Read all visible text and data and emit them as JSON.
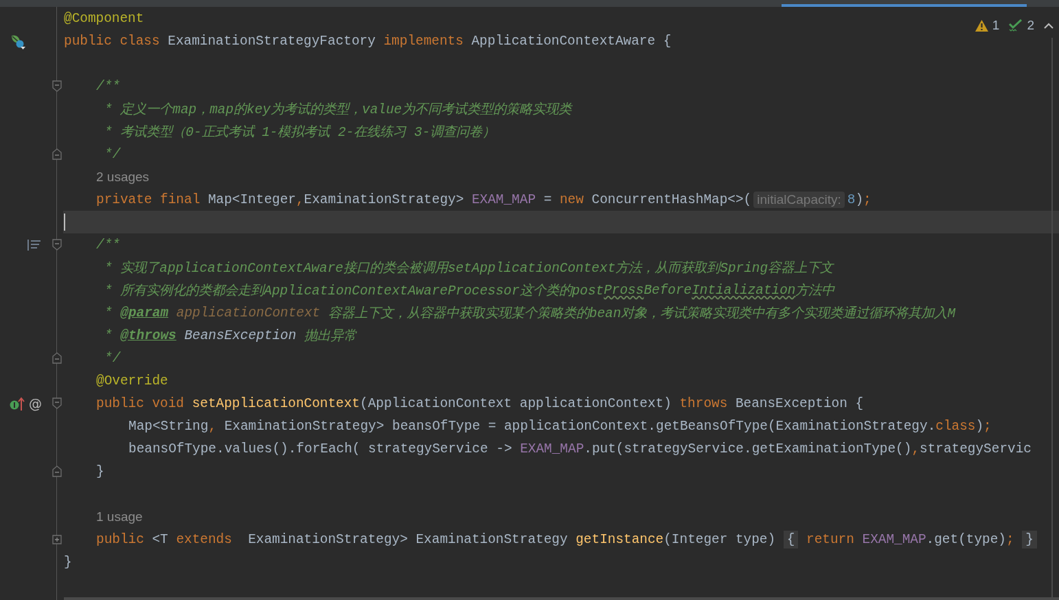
{
  "inspections": [
    {
      "kind": "warning",
      "count": "1"
    },
    {
      "kind": "typo",
      "count": "2"
    }
  ],
  "lines": [
    {
      "kind": "code",
      "block": {
        "kind": "top"
      },
      "tokens": [
        {
          "kind": "annot",
          "text": "@Component"
        }
      ]
    },
    {
      "kind": "code",
      "block": {
        "kind": "top"
      },
      "gutter": [
        {
          "kind": "bean"
        }
      ],
      "tokens": [
        {
          "kind": "kw",
          "text": "public class "
        },
        {
          "kind": "plain",
          "text": "ExaminationStrategyFactory "
        },
        {
          "kind": "kw",
          "text": "implements "
        },
        {
          "kind": "plain",
          "text": "ApplicationContextAware {"
        }
      ]
    },
    {
      "kind": "code",
      "block": {
        "kind": "top"
      }
    },
    {
      "kind": "code",
      "block": {
        "kind": "member"
      },
      "fold": {
        "kind": "start"
      },
      "tokens": [
        {
          "kind": "doc",
          "text": "/**"
        }
      ]
    },
    {
      "kind": "code",
      "block": {
        "kind": "doc"
      },
      "tokens": [
        {
          "kind": "doc",
          "text": "* 定义一个map，map的key为考试的类型，value为不同考试类型的策略实现类"
        }
      ]
    },
    {
      "kind": "code",
      "block": {
        "kind": "doc"
      },
      "tokens": [
        {
          "kind": "doc",
          "text": "* 考试类型（0-正式考试 1-模拟考试 2-在线练习 3-调查问卷）"
        }
      ]
    },
    {
      "kind": "code",
      "block": {
        "kind": "doc"
      },
      "fold": {
        "kind": "end"
      },
      "tokens": [
        {
          "kind": "doc",
          "text": "*/"
        }
      ]
    },
    {
      "kind": "code",
      "block": {
        "kind": "member"
      },
      "tokens": [
        {
          "kind": "usage",
          "text": "2 usages"
        }
      ]
    },
    {
      "kind": "code",
      "block": {
        "kind": "member"
      },
      "tokens": [
        {
          "kind": "kw",
          "text": "private final "
        },
        {
          "kind": "plain",
          "text": "Map<Integer"
        },
        {
          "kind": "kw",
          "text": ","
        },
        {
          "kind": "plain",
          "text": "ExaminationStrategy> "
        },
        {
          "kind": "field",
          "text": "EXAM_MAP"
        },
        {
          "kind": "plain",
          "text": " = "
        },
        {
          "kind": "kw",
          "text": "new "
        },
        {
          "kind": "plain",
          "text": "ConcurrentHashMap<>("
        },
        {
          "kind": "hint",
          "text": "initialCapacity:"
        },
        {
          "kind": "num",
          "text": "8"
        },
        {
          "kind": "plain",
          "text": ")"
        },
        {
          "kind": "kw",
          "text": ";"
        }
      ]
    },
    {
      "kind": "caret",
      "block": {
        "kind": "top"
      }
    },
    {
      "kind": "code",
      "block": {
        "kind": "member"
      },
      "fold": {
        "kind": "start"
      },
      "gutter": [
        {
          "kind": "doc-render"
        }
      ],
      "tokens": [
        {
          "kind": "doc",
          "text": "/**"
        }
      ]
    },
    {
      "kind": "code",
      "block": {
        "kind": "doc"
      },
      "tokens": [
        {
          "kind": "doc",
          "text": "* 实现了applicationContextAware接口的类会被调用setApplicationContext方法，从而获取到Spring容器上下文"
        }
      ]
    },
    {
      "kind": "code",
      "block": {
        "kind": "doc"
      },
      "tokens": [
        {
          "kind": "doc",
          "text": "* 所有实例化的类都会走到ApplicationContextAwareProcessor这个类的post"
        },
        {
          "kind": "typo",
          "text": "Pross"
        },
        {
          "kind": "doc",
          "text": "Before"
        },
        {
          "kind": "typo",
          "text": "Intialization"
        },
        {
          "kind": "doc",
          "text": "方法中"
        }
      ]
    },
    {
      "kind": "code",
      "block": {
        "kind": "doc"
      },
      "tokens": [
        {
          "kind": "doc",
          "text": "* "
        },
        {
          "kind": "doctag",
          "text": "@param"
        },
        {
          "kind": "docparam",
          "text": " applicationContext"
        },
        {
          "kind": "doc",
          "text": " 容器上下文，从容器中获取实现某个策略类的bean对象，考试策略实现类中有多个实现类通过循环将其加入M"
        }
      ]
    },
    {
      "kind": "code",
      "block": {
        "kind": "doc"
      },
      "tokens": [
        {
          "kind": "doc",
          "text": "* "
        },
        {
          "kind": "doctag",
          "text": "@throws"
        },
        {
          "kind": "docref",
          "text": " BeansException"
        },
        {
          "kind": "doc",
          "text": " 抛出异常"
        }
      ]
    },
    {
      "kind": "code",
      "block": {
        "kind": "doc"
      },
      "fold": {
        "kind": "end"
      },
      "tokens": [
        {
          "kind": "doc",
          "text": "*/"
        }
      ]
    },
    {
      "kind": "code",
      "block": {
        "kind": "member"
      },
      "tokens": [
        {
          "kind": "annot",
          "text": "@Override"
        }
      ]
    },
    {
      "kind": "code",
      "block": {
        "kind": "member"
      },
      "fold": {
        "kind": "start"
      },
      "gutter": [
        {
          "kind": "implements"
        },
        {
          "kind": "mark",
          "text": "@"
        }
      ],
      "tokens": [
        {
          "kind": "kw",
          "text": "public void "
        },
        {
          "kind": "method",
          "text": "setApplicationContext"
        },
        {
          "kind": "plain",
          "text": "(ApplicationContext applicationContext) "
        },
        {
          "kind": "kw",
          "text": "throws "
        },
        {
          "kind": "plain",
          "text": "BeansException {"
        }
      ]
    },
    {
      "kind": "code",
      "block": {
        "kind": "body"
      },
      "tokens": [
        {
          "kind": "plain",
          "text": "Map<String"
        },
        {
          "kind": "kw",
          "text": ","
        },
        {
          "kind": "plain",
          "text": " ExaminationStrategy> beansOfType = applicationContext.getBeansOfType(ExaminationStrategy."
        },
        {
          "kind": "kw",
          "text": "class"
        },
        {
          "kind": "plain",
          "text": ")"
        },
        {
          "kind": "kw",
          "text": ";"
        }
      ]
    },
    {
      "kind": "code",
      "block": {
        "kind": "body"
      },
      "tokens": [
        {
          "kind": "plain",
          "text": "beansOfType.values().forEach( strategyService -> "
        },
        {
          "kind": "field",
          "text": "EXAM_MAP"
        },
        {
          "kind": "plain",
          "text": ".put(strategyService.getExaminationType()"
        },
        {
          "kind": "kw",
          "text": ","
        },
        {
          "kind": "plain",
          "text": "strategyServic"
        }
      ]
    },
    {
      "kind": "code",
      "block": {
        "kind": "member"
      },
      "fold": {
        "kind": "end"
      },
      "tokens": [
        {
          "kind": "plain",
          "text": "}"
        }
      ]
    },
    {
      "kind": "code",
      "block": {
        "kind": "top"
      }
    },
    {
      "kind": "code",
      "block": {
        "kind": "member"
      },
      "tokens": [
        {
          "kind": "usage",
          "text": "1 usage"
        }
      ]
    },
    {
      "kind": "code",
      "block": {
        "kind": "member"
      },
      "fold": {
        "kind": "collapsed"
      },
      "tokens": [
        {
          "kind": "kw",
          "text": "public "
        },
        {
          "kind": "plain",
          "text": "<T "
        },
        {
          "kind": "kw",
          "text": "extends  "
        },
        {
          "kind": "plain",
          "text": "ExaminationStrategy> ExaminationStrategy "
        },
        {
          "kind": "method",
          "text": "getInstance"
        },
        {
          "kind": "plain",
          "text": "(Integer type) "
        },
        {
          "kind": "folded",
          "text": "{"
        },
        {
          "kind": "kw",
          "text": " return "
        },
        {
          "kind": "field",
          "text": "EXAM_MAP"
        },
        {
          "kind": "plain",
          "text": ".get(type)"
        },
        {
          "kind": "kw",
          "text": "; "
        },
        {
          "kind": "folded",
          "text": "}"
        }
      ]
    },
    {
      "kind": "code",
      "block": {
        "kind": "top"
      },
      "tokens": [
        {
          "kind": "plain",
          "text": "}"
        }
      ]
    }
  ]
}
